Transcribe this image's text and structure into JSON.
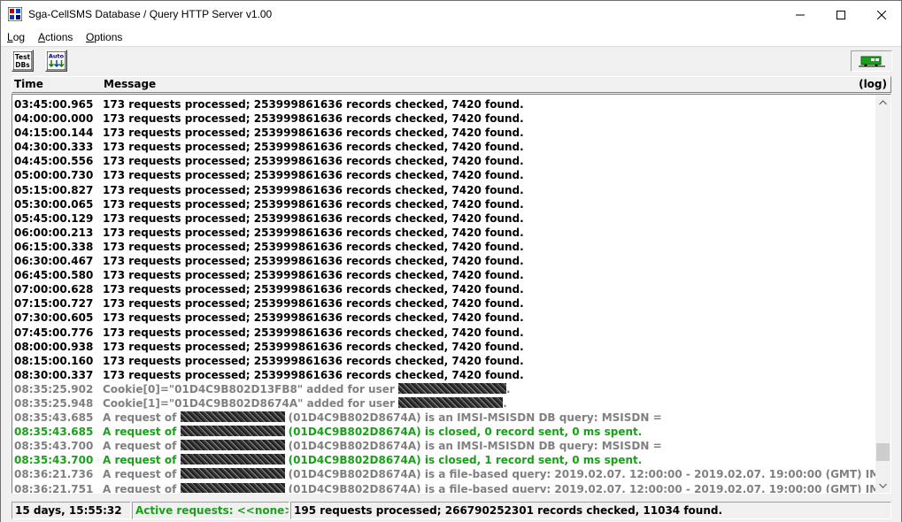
{
  "window": {
    "title": "Sga-CellSMS Database / Query HTTP Server  v1.00"
  },
  "menu": [
    {
      "label_u": "L",
      "label_rest": "og"
    },
    {
      "label_u": "A",
      "label_rest": "ctions"
    },
    {
      "label_u": "O",
      "label_rest": "ptions"
    }
  ],
  "toolbar": {
    "test_label_top": "Test",
    "test_label_bottom": "DBs",
    "auto_label": "Auto"
  },
  "log": {
    "headers": {
      "time": "Time",
      "message": "Message",
      "log": "(log)"
    },
    "rows": [
      {
        "time": "03:45:00.965",
        "message": "173 requests processed; 253999861636 records checked, 7420 found.",
        "color": "black"
      },
      {
        "time": "04:00:00.000",
        "message": "173 requests processed; 253999861636 records checked, 7420 found.",
        "color": "black"
      },
      {
        "time": "04:15:00.144",
        "message": "173 requests processed; 253999861636 records checked, 7420 found.",
        "color": "black"
      },
      {
        "time": "04:30:00.333",
        "message": "173 requests processed; 253999861636 records checked, 7420 found.",
        "color": "black"
      },
      {
        "time": "04:45:00.556",
        "message": "173 requests processed; 253999861636 records checked, 7420 found.",
        "color": "black"
      },
      {
        "time": "05:00:00.730",
        "message": "173 requests processed; 253999861636 records checked, 7420 found.",
        "color": "black"
      },
      {
        "time": "05:15:00.827",
        "message": "173 requests processed; 253999861636 records checked, 7420 found.",
        "color": "black"
      },
      {
        "time": "05:30:00.065",
        "message": "173 requests processed; 253999861636 records checked, 7420 found.",
        "color": "black"
      },
      {
        "time": "05:45:00.129",
        "message": "173 requests processed; 253999861636 records checked, 7420 found.",
        "color": "black"
      },
      {
        "time": "06:00:00.213",
        "message": "173 requests processed; 253999861636 records checked, 7420 found.",
        "color": "black"
      },
      {
        "time": "06:15:00.338",
        "message": "173 requests processed; 253999861636 records checked, 7420 found.",
        "color": "black"
      },
      {
        "time": "06:30:00.467",
        "message": "173 requests processed; 253999861636 records checked, 7420 found.",
        "color": "black"
      },
      {
        "time": "06:45:00.580",
        "message": "173 requests processed; 253999861636 records checked, 7420 found.",
        "color": "black"
      },
      {
        "time": "07:00:00.628",
        "message": "173 requests processed; 253999861636 records checked, 7420 found.",
        "color": "black"
      },
      {
        "time": "07:15:00.727",
        "message": "173 requests processed; 253999861636 records checked, 7420 found.",
        "color": "black"
      },
      {
        "time": "07:30:00.605",
        "message": "173 requests processed; 253999861636 records checked, 7420 found.",
        "color": "black"
      },
      {
        "time": "07:45:00.776",
        "message": "173 requests processed; 253999861636 records checked, 7420 found.",
        "color": "black"
      },
      {
        "time": "08:00:00.938",
        "message": "173 requests processed; 253999861636 records checked, 7420 found.",
        "color": "black"
      },
      {
        "time": "08:15:00.160",
        "message": "173 requests processed; 253999861636 records checked, 7420 found.",
        "color": "black"
      },
      {
        "time": "08:30:00.337",
        "message": "173 requests processed; 253999861636 records checked, 7420 found.",
        "color": "black"
      },
      {
        "time": "08:35:25.902",
        "pre": "Cookie[0]=\"01D4C9B802D13FB8\" added for user ",
        "post": ".",
        "color": "gray"
      },
      {
        "time": "08:35:25.948",
        "pre": "Cookie[1]=\"01D4C9B802D8674A\" added for user ",
        "post": ".",
        "color": "gray"
      },
      {
        "time": "08:35:43.685",
        "pre": "A request of ",
        "post": " (01D4C9B802D8674A) is an IMSI-MSISDN DB query:  MSISDN = ",
        "color": "gray"
      },
      {
        "time": "08:35:43.685",
        "pre": "A request of ",
        "post": " (01D4C9B802D8674A) is closed, 0 record sent, 0 ms spent.",
        "color": "green"
      },
      {
        "time": "08:35:43.700",
        "pre": "A request of ",
        "post": " (01D4C9B802D8674A) is an IMSI-MSISDN DB query:  MSISDN = ",
        "color": "gray"
      },
      {
        "time": "08:35:43.700",
        "pre": "A request of ",
        "post": " (01D4C9B802D8674A) is closed, 1 record sent, 0 ms spent.",
        "color": "green"
      },
      {
        "time": "08:36:21.736",
        "pre": "A request of ",
        "post": " (01D4C9B802D8674A) is a file-based query:  2019.02.07. 12:00:00 - 2019.02.07. 19:00:00 (GMT)  IMSI = '",
        "color": "gray"
      },
      {
        "time": "08:36:21.751",
        "pre": "A request of ",
        "post": " (01D4C9B802D8674A) is a file-based query:  2019.02.07. 12:00:00 - 2019.02.07. 19:00:00 (GMT)  IMSI = '",
        "color": "gray"
      }
    ]
  },
  "status": {
    "uptime": "15 days, 15:55:32",
    "active": "Active requests: <<none>>",
    "summary": "195 requests processed;  266790252301 records checked, 11034 found."
  },
  "colors": {
    "green": "#1aa01a",
    "gray": "#808080",
    "black": "#000000"
  }
}
